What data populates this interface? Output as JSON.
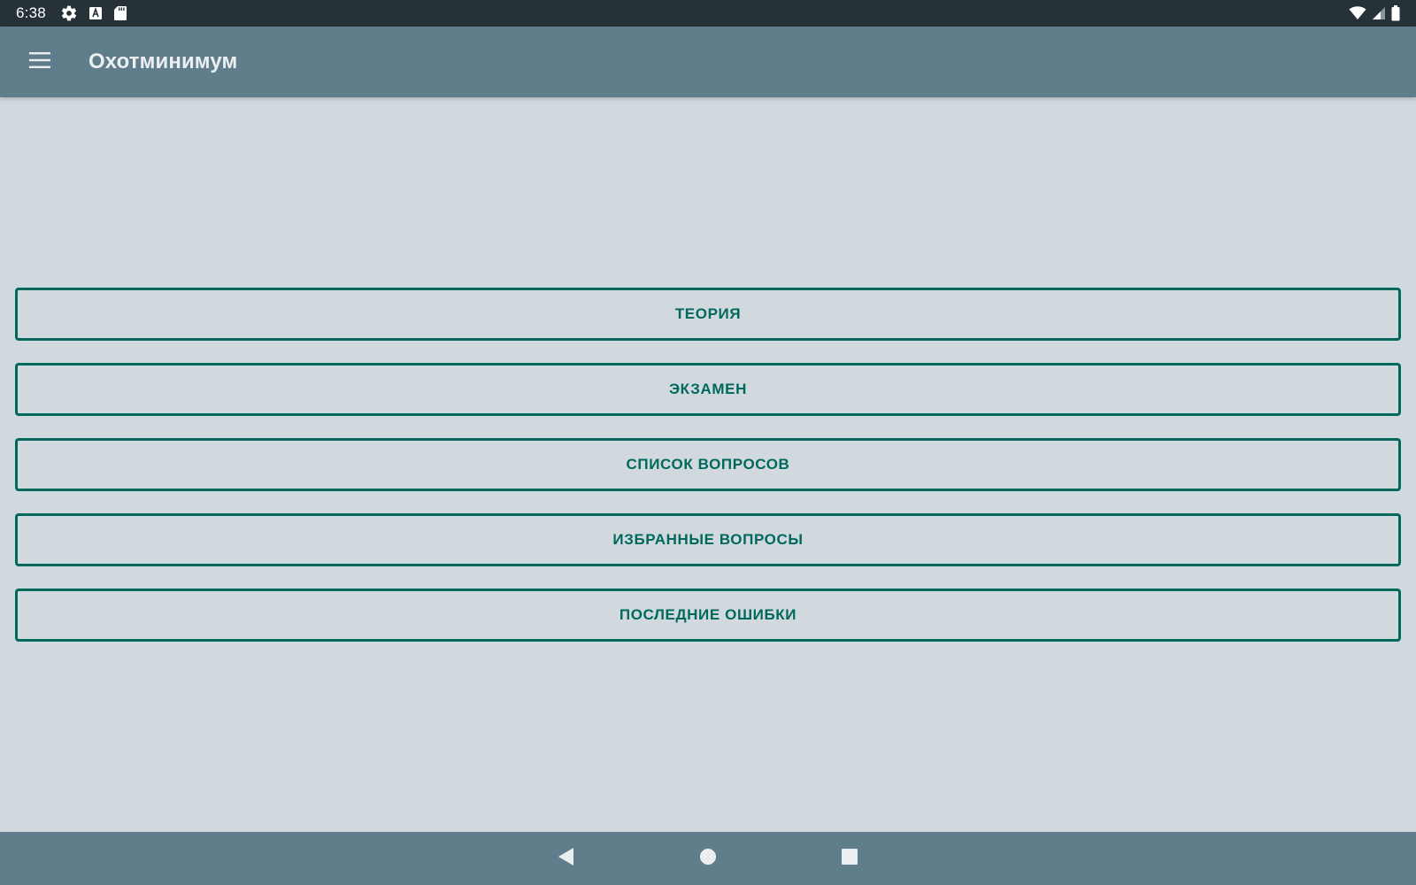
{
  "status_bar": {
    "time": "6:38",
    "left_icons": [
      "gear-icon",
      "keyboard-a-icon",
      "sd-card-icon"
    ],
    "right_icons": [
      "wifi-icon",
      "cell-signal-icon",
      "battery-icon"
    ]
  },
  "app_bar": {
    "menu_icon": "hamburger-menu-icon",
    "title": "Охотминимум"
  },
  "menu": {
    "items": [
      {
        "label": "ТЕОРИЯ"
      },
      {
        "label": "ЭКЗАМЕН"
      },
      {
        "label": "СПИСОК ВОПРОСОВ"
      },
      {
        "label": "ИЗБРАННЫЕ ВОПРОСЫ"
      },
      {
        "label": "ПОСЛЕДНИЕ ОШИБКИ"
      }
    ]
  },
  "nav_bar": {
    "buttons": [
      "back-icon",
      "home-icon",
      "recents-icon"
    ]
  },
  "colors": {
    "status_bar": "#263238",
    "app_bar": "#607d8b",
    "background": "#d1d9df",
    "accent": "#00695c",
    "title_text": "#eceff1"
  }
}
